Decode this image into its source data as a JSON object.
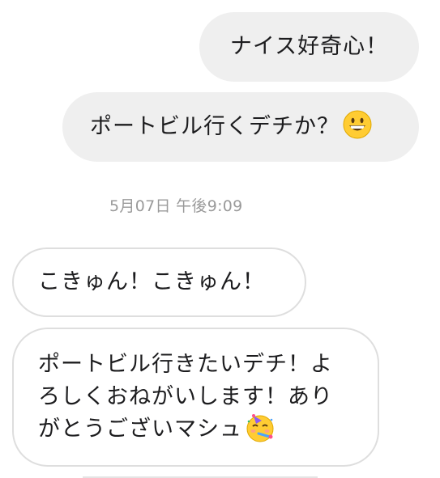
{
  "messages": [
    {
      "direction": "outgoing",
      "text": "ナイス好奇心！"
    },
    {
      "direction": "outgoing",
      "text": "ポートビル行くデチか？",
      "emoji": "grinning-face-emoji"
    },
    {
      "direction": "incoming",
      "text": "こきゅん！こきゅん！"
    },
    {
      "direction": "incoming",
      "text": "ポートビル行きたいデチ！よろしくおねがいします！ありがとうございマシュ",
      "emoji": "partying-face-emoji"
    }
  ],
  "timestamp": "5月07日 午後9:09",
  "colors": {
    "outgoing_bubble": "#efefef",
    "incoming_border": "#dedede",
    "timestamp_text": "#9a9a9a",
    "text": "#1c1c1e"
  }
}
